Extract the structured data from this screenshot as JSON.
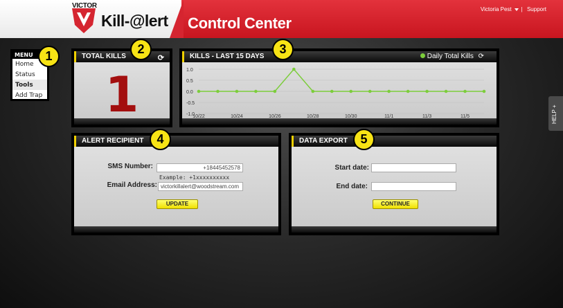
{
  "header": {
    "brand_small": "VICTOR",
    "brand_name": "Kill-@lert",
    "app_title": "Control Center",
    "user_name": "Victoria Pest",
    "support_link": "Support",
    "separator": "|"
  },
  "menu": {
    "title": "MENU",
    "items": [
      {
        "label": "Home"
      },
      {
        "label": "Status"
      },
      {
        "label": "Tools"
      },
      {
        "label": "Add Trap"
      }
    ]
  },
  "total_kills": {
    "title": "TOTAL KILLS",
    "value": "1"
  },
  "kills_chart": {
    "title": "KILLS - LAST 15 DAYS",
    "legend": "Daily Total Kills"
  },
  "chart_data": {
    "type": "line",
    "x": [
      "10/22",
      "10/23",
      "10/24",
      "10/25",
      "10/26",
      "10/27",
      "10/28",
      "10/29",
      "10/30",
      "10/31",
      "11/1",
      "11/2",
      "11/3",
      "11/4",
      "11/5",
      "11/6"
    ],
    "values": [
      0,
      0,
      0,
      0,
      0,
      1,
      0,
      0,
      0,
      0,
      0,
      0,
      0,
      0,
      0,
      0
    ],
    "tick_labels": [
      "10/22",
      "10/24",
      "10/26",
      "10/28",
      "10/30",
      "11/1",
      "11/3",
      "11/5"
    ],
    "y_ticks": [
      "1.0",
      "0.5",
      "0.0",
      "-0.5",
      "-1.0"
    ],
    "ylim": [
      -1,
      1
    ],
    "series": [
      {
        "name": "Daily Total Kills",
        "color": "#7ccd3b"
      }
    ],
    "grid": true
  },
  "alert": {
    "title": "ALERT RECIPIENT",
    "sms_label": "SMS Number:",
    "sms_value": "+18445452578",
    "sms_hint": "Example: +1xxxxxxxxxx",
    "email_label": "Email Address:",
    "email_value": "victorkillalert@woodstream.com",
    "update_button": "UPDATE"
  },
  "export": {
    "title": "DATA EXPORT",
    "start_label": "Start date:",
    "end_label": "End date:",
    "start_value": "",
    "end_value": "",
    "continue_button": "CONTINUE"
  },
  "help": {
    "label": "HELP +"
  },
  "callouts": [
    "1",
    "2",
    "3",
    "4",
    "5"
  ],
  "colors": {
    "brand_red": "#d52530",
    "accent_yellow": "#f7e315",
    "kill_count": "#a30f0f",
    "series_green": "#7ccd3b"
  }
}
